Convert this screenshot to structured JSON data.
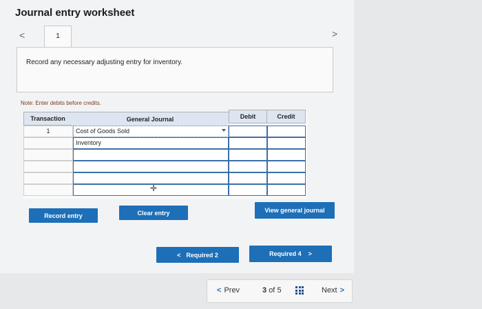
{
  "worksheet": {
    "title": "Journal entry worksheet",
    "tab_label": "1",
    "prompt": "Record any necessary adjusting entry for inventory.",
    "note": "Note: Enter debits before credits."
  },
  "journal": {
    "headers": {
      "transaction": "Transaction",
      "general_journal": "General Journal",
      "debit": "Debit",
      "credit": "Credit"
    },
    "rows": [
      {
        "transaction": "1",
        "account": "Cost of Goods Sold",
        "debit": "",
        "credit": ""
      },
      {
        "transaction": "",
        "account": "Inventory",
        "debit": "",
        "credit": ""
      },
      {
        "transaction": "",
        "account": "",
        "debit": "",
        "credit": ""
      },
      {
        "transaction": "",
        "account": "",
        "debit": "",
        "credit": ""
      },
      {
        "transaction": "",
        "account": "",
        "debit": "",
        "credit": ""
      },
      {
        "transaction": "",
        "account": "",
        "debit": "",
        "credit": ""
      }
    ]
  },
  "buttons": {
    "record_entry": "Record entry",
    "clear_entry": "Clear entry",
    "view_general_journal": "View general journal",
    "required_prev": "Required 2",
    "required_next": "Required 4"
  },
  "pager": {
    "prev": "Prev",
    "current": "3",
    "of": "of",
    "total": "5",
    "next": "Next"
  },
  "icons": {
    "left_chevron": "chevron-left-icon",
    "right_chevron": "chevron-right-icon",
    "dropdown": "chevron-down-icon",
    "grid": "grid-icon",
    "cursor": "move-cursor-icon"
  },
  "colors": {
    "primary_button": "#1d6fb8",
    "header_fill": "#dde6f0",
    "note_text": "#7a3b1a"
  }
}
